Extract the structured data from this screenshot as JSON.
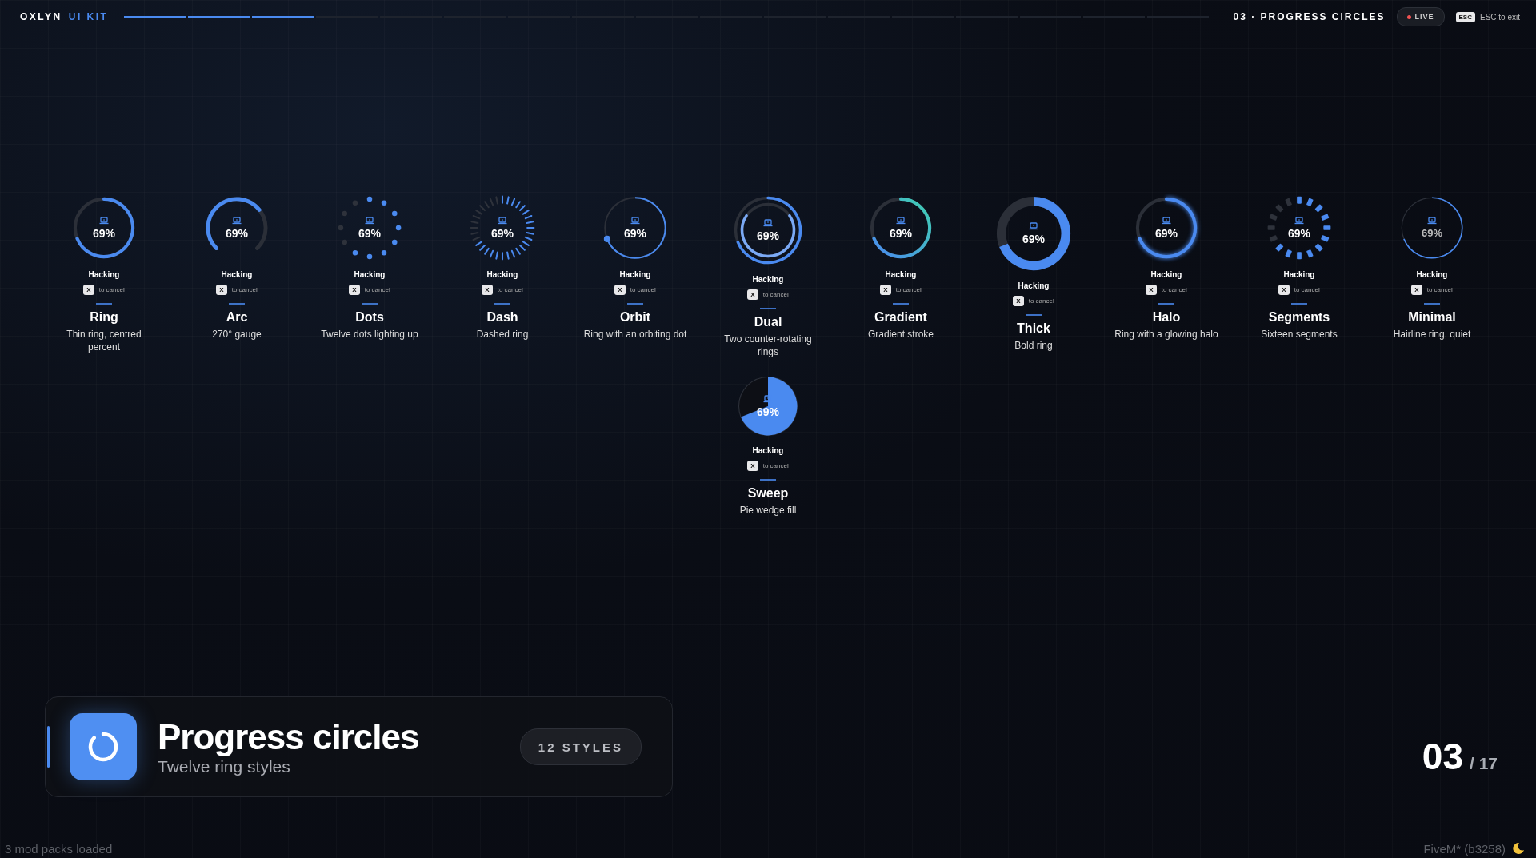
{
  "header": {
    "brand": "OXLYN",
    "brand_suffix": "UI KIT",
    "segments": [
      {
        "on": true
      },
      {
        "on": true
      },
      {
        "on": true
      },
      {
        "on": false
      },
      {
        "on": false
      },
      {
        "on": false
      },
      {
        "on": false
      },
      {
        "on": false
      },
      {
        "on": false
      },
      {
        "on": false
      },
      {
        "on": false
      },
      {
        "on": false
      },
      {
        "on": false
      },
      {
        "on": false
      },
      {
        "on": false
      },
      {
        "on": false
      },
      {
        "on": false
      }
    ],
    "section": "03 · PROGRESS CIRCLES",
    "live": "LIVE",
    "esc_key": "ESC",
    "esc_hint": "ESC to exit"
  },
  "cards": [
    {
      "kind": "ring",
      "percent": "69%",
      "status": "Hacking",
      "key": "X",
      "hint": "to cancel",
      "name": "Ring",
      "description": "Thin ring, centred percent"
    },
    {
      "kind": "arc",
      "percent": "69%",
      "status": "Hacking",
      "key": "X",
      "hint": "to cancel",
      "name": "Arc",
      "description": "270° gauge"
    },
    {
      "kind": "dots",
      "percent": "69%",
      "level": 0.69,
      "status": "Hacking",
      "key": "X",
      "hint": "to cancel",
      "name": "Dots",
      "description": "Twelve dots lighting up"
    },
    {
      "kind": "dash",
      "percent": "69%",
      "level": 0.69,
      "status": "Hacking",
      "key": "X",
      "hint": "to cancel",
      "name": "Dash",
      "description": "Dashed ring"
    },
    {
      "kind": "orbit",
      "percent": "69%",
      "status": "Hacking",
      "key": "X",
      "hint": "to cancel",
      "name": "Orbit",
      "description": "Ring with an orbiting dot"
    },
    {
      "kind": "dual",
      "percent": "69%",
      "status": "Hacking",
      "key": "X",
      "hint": "to cancel",
      "name": "Dual",
      "description": "Two counter-rotating rings"
    },
    {
      "kind": "gradient",
      "percent": "69%",
      "status": "Hacking",
      "key": "X",
      "hint": "to cancel",
      "name": "Gradient",
      "description": "Gradient stroke"
    },
    {
      "kind": "thick",
      "percent": "69%",
      "status": "Hacking",
      "key": "X",
      "hint": "to cancel",
      "name": "Thick",
      "description": "Bold ring"
    },
    {
      "kind": "halo",
      "percent": "69%",
      "status": "Hacking",
      "key": "X",
      "hint": "to cancel",
      "name": "Halo",
      "description": "Ring with a glowing halo"
    },
    {
      "kind": "segments",
      "percent": "69%",
      "level": 0.69,
      "status": "Hacking",
      "key": "X",
      "hint": "to cancel",
      "name": "Segments",
      "description": "Sixteen segments"
    },
    {
      "kind": "minimal",
      "percent": "69%",
      "status": "Hacking",
      "key": "X",
      "hint": "to cancel",
      "name": "Minimal",
      "description": "Hairline ring, quiet"
    },
    {
      "kind": "sweep",
      "percent": "69%",
      "status": "Hacking",
      "key": "X",
      "hint": "to cancel",
      "name": "Sweep",
      "description": "Pie wedge fill"
    }
  ],
  "info_card": {
    "title": "Progress circles",
    "subtitle": "Twelve ring styles",
    "badge": "12 STYLES"
  },
  "page_counter": {
    "current": "03",
    "total": "/ 17"
  },
  "status_left": "3 mod packs loaded",
  "status_right": "FiveM* (b3258)"
}
